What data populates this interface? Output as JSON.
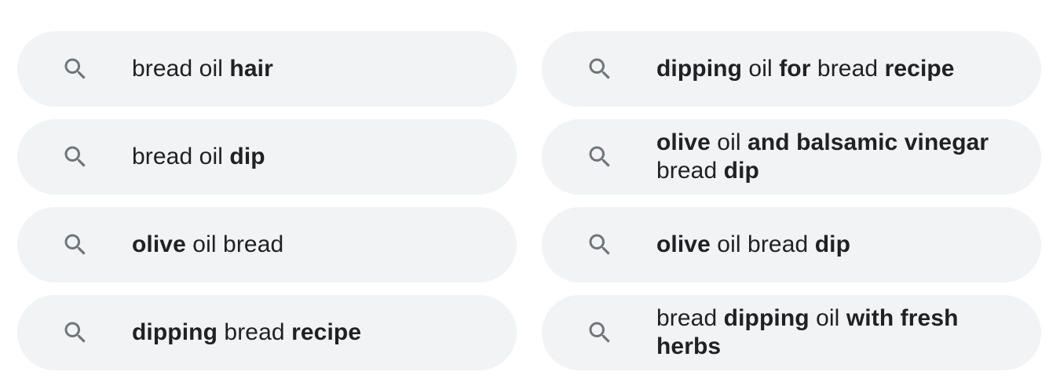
{
  "suggestions": [
    {
      "segments": [
        {
          "t": "bread oil ",
          "b": false
        },
        {
          "t": "hair",
          "b": true
        }
      ]
    },
    {
      "segments": [
        {
          "t": "dipping",
          "b": true
        },
        {
          "t": " oil ",
          "b": false
        },
        {
          "t": "for",
          "b": true
        },
        {
          "t": " bread ",
          "b": false
        },
        {
          "t": "recipe",
          "b": true
        }
      ]
    },
    {
      "segments": [
        {
          "t": "bread oil ",
          "b": false
        },
        {
          "t": "dip",
          "b": true
        }
      ]
    },
    {
      "segments": [
        {
          "t": "olive",
          "b": true
        },
        {
          "t": " oil ",
          "b": false
        },
        {
          "t": "and balsamic vinegar",
          "b": true
        },
        {
          "t": " bread ",
          "b": false
        },
        {
          "t": "dip",
          "b": true
        }
      ]
    },
    {
      "segments": [
        {
          "t": "olive",
          "b": true
        },
        {
          "t": " oil bread",
          "b": false
        }
      ]
    },
    {
      "segments": [
        {
          "t": "olive",
          "b": true
        },
        {
          "t": " oil bread ",
          "b": false
        },
        {
          "t": "dip",
          "b": true
        }
      ]
    },
    {
      "segments": [
        {
          "t": "dipping",
          "b": true
        },
        {
          "t": " bread ",
          "b": false
        },
        {
          "t": "recipe",
          "b": true
        }
      ]
    },
    {
      "segments": [
        {
          "t": "bread ",
          "b": false
        },
        {
          "t": "dipping",
          "b": true
        },
        {
          "t": " oil ",
          "b": false
        },
        {
          "t": "with fresh herbs",
          "b": true
        }
      ]
    }
  ],
  "icon": "search-icon",
  "colors": {
    "chip_background": "#f1f3f4",
    "text": "#202124",
    "icon": "#70757a"
  }
}
